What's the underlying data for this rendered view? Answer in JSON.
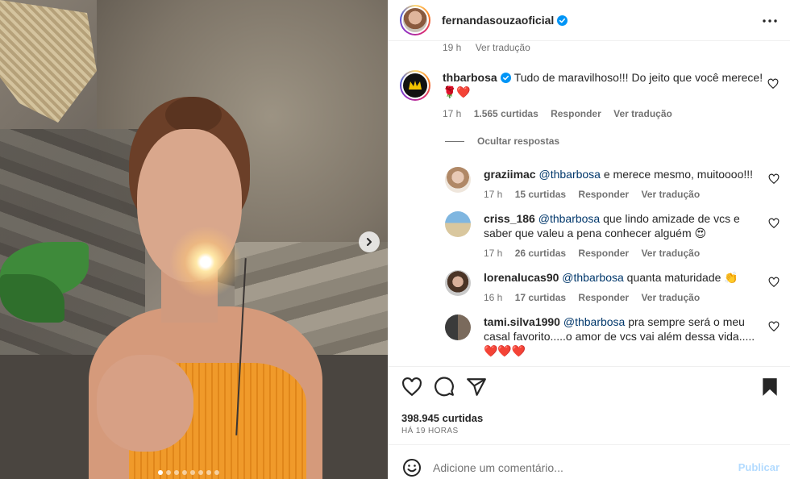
{
  "post": {
    "username": "fernandasouzaoficial",
    "likes": "398.945 curtidas",
    "time_ago": "HÁ 19 HORAS",
    "carousel_dots": 8,
    "carousel_active": 0
  },
  "prev_comment_meta": {
    "time": "19 h",
    "translate": "Ver tradução"
  },
  "comments": [
    {
      "username": "thbarbosa",
      "text": "Tudo de maravilhoso!!! Do jeito que você merece! 🌹❤️",
      "time": "17 h",
      "likes": "1.565 curtidas",
      "reply": "Responder",
      "translate": "Ver tradução",
      "hide_replies": "Ocultar respostas",
      "replies": [
        {
          "username": "graziimac",
          "mention": "@thbarbosa",
          "text": " e merece mesmo, muitoooo!!!",
          "time": "17 h",
          "likes": "15 curtidas",
          "reply": "Responder",
          "translate": "Ver tradução"
        },
        {
          "username": "criss_186",
          "mention": "@thbarbosa",
          "text": " que lindo amizade de vcs e saber que valeu a pena conhecer alguém 😍",
          "time": "17 h",
          "likes": "26 curtidas",
          "reply": "Responder",
          "translate": "Ver tradução"
        },
        {
          "username": "lorenalucas90",
          "mention": "@thbarbosa",
          "text": " quanta maturidade 👏",
          "time": "16 h",
          "likes": "17 curtidas",
          "reply": "Responder",
          "translate": "Ver tradução"
        },
        {
          "username": "tami.silva1990",
          "mention": "@thbarbosa",
          "text": " pra sempre será o meu casal favorito.....o amor de vcs vai além dessa vida..... ❤️❤️❤️"
        }
      ]
    }
  ],
  "comment_box": {
    "placeholder": "Adicione um comentário...",
    "publish": "Publicar"
  },
  "colors": {
    "verified": "#0095f6",
    "link": "#00376b",
    "muted": "#737373",
    "publish_disabled": "#b3dbff"
  }
}
